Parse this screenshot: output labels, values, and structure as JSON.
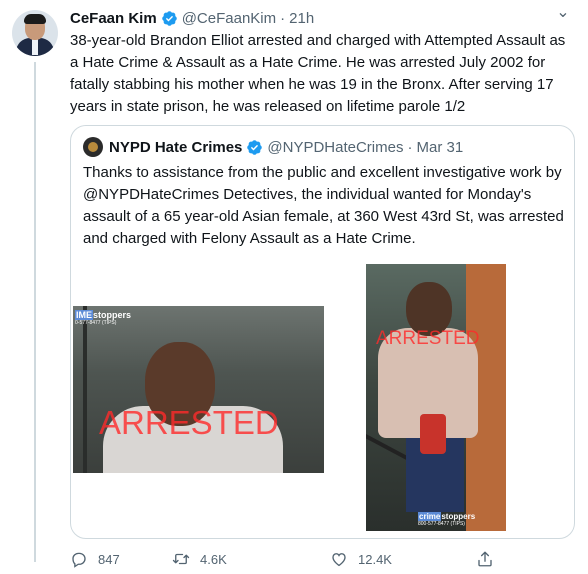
{
  "tweet": {
    "author_name": "CeFaan Kim",
    "handle": "@CeFaanKim",
    "separator": "·",
    "time": "21h",
    "text": "38-year-old Brandon Elliot arrested and charged with Attempted Assault as a Hate Crime & Assault as a Hate Crime. He was arrested July 2002 for fatally stabbing his mother when he was 19 in the Bronx. After serving 17 years in state prison, he was released on lifetime parole 1/2"
  },
  "quote": {
    "author_name": "NYPD Hate Crimes",
    "handle": "@NYPDHateCrimes",
    "separator": "·",
    "date": "Mar 31",
    "text": "Thanks to assistance from the public and excellent investigative work by @NYPDHateCrimes Detectives, the individual wanted for Monday's assault of a 65 year-old Asian female, at 360 West 43rd St, was arrested and charged with Felony Assault as a Hate Crime.",
    "images": [
      {
        "overlay": "ARRESTED",
        "logo": "stoppers",
        "logo_prefix": "IME",
        "tips": "0-577-8477 (TIPS)"
      },
      {
        "overlay": "ARRESTED",
        "logo": "stoppers",
        "logo_prefix": "crime",
        "tips": "800-577-8477 (TIPS)"
      }
    ]
  },
  "actions": {
    "replies": "847",
    "retweets": "4.6K",
    "likes": "12.4K"
  },
  "colors": {
    "verified": "#1d9bf0",
    "muted": "#536471",
    "border": "#cfd9de",
    "overlay": "#ff2b2b"
  },
  "icons": [
    "verified-badge-icon",
    "more-icon",
    "reply-icon",
    "retweet-icon",
    "like-icon",
    "share-icon"
  ]
}
